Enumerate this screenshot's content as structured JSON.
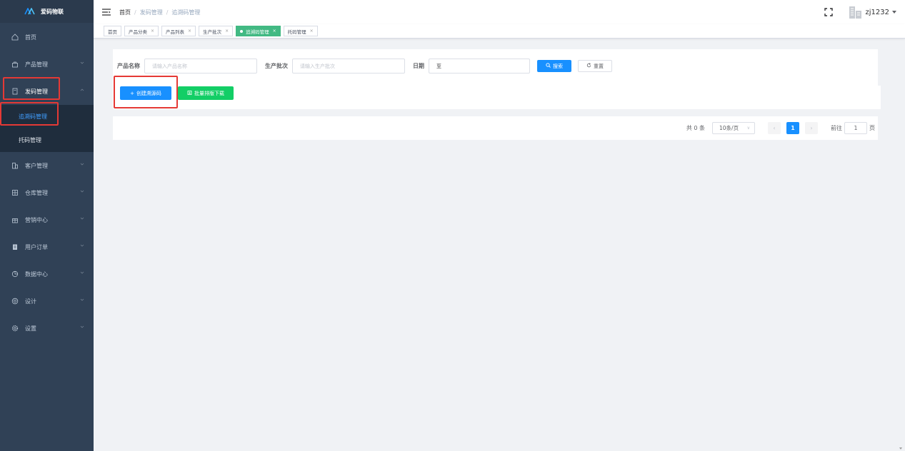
{
  "app": {
    "name": "爱码物联"
  },
  "sidebar": {
    "items": [
      {
        "label": "首页",
        "icon": "home-icon"
      },
      {
        "label": "产品管理",
        "icon": "shopping-bag-icon"
      },
      {
        "label": "发码管理",
        "icon": "document-icon"
      },
      {
        "label": "客户管理",
        "icon": "building-icon"
      },
      {
        "label": "仓库管理",
        "icon": "grid-icon"
      },
      {
        "label": "营销中心",
        "icon": "gift-icon"
      },
      {
        "label": "用户订单",
        "icon": "clipboard-icon"
      },
      {
        "label": "数据中心",
        "icon": "pie-chart-icon"
      },
      {
        "label": "设计",
        "icon": "flower-icon"
      },
      {
        "label": "设置",
        "icon": "gear-icon"
      }
    ],
    "submenu": [
      {
        "label": "追溯码管理"
      },
      {
        "label": "托码管理"
      }
    ]
  },
  "navbar": {
    "breadcrumb": [
      "首页",
      "发码管理",
      "追溯码管理"
    ],
    "username": "zj1232"
  },
  "tags": [
    {
      "label": "首页",
      "closable": false
    },
    {
      "label": "产品分类",
      "closable": true
    },
    {
      "label": "产品列表",
      "closable": true
    },
    {
      "label": "生产批次",
      "closable": true
    },
    {
      "label": "追溯码管理",
      "closable": true,
      "active": true
    },
    {
      "label": "托码管理",
      "closable": true
    }
  ],
  "search": {
    "product_name_label": "产品名称",
    "product_name_placeholder": "请输入产品名称",
    "batch_label": "生产批次",
    "batch_placeholder": "请输入生产批次",
    "date_label": "日期",
    "date_separator": "至",
    "search_button": "搜索",
    "reset_button": "重置"
  },
  "actions": {
    "create_button": "创建溯源码",
    "batch_download_button": "批量排版下载"
  },
  "pagination": {
    "total_text": "共 0 条",
    "page_size": "10条/页",
    "current_page": "1",
    "goto_prefix": "前往",
    "goto_value": "1",
    "goto_suffix": "页"
  },
  "colors": {
    "sidebar_bg": "#304156",
    "primary": "#1890ff",
    "success": "#13ce66",
    "tag_active": "#42b983",
    "highlight": "#e53935"
  }
}
